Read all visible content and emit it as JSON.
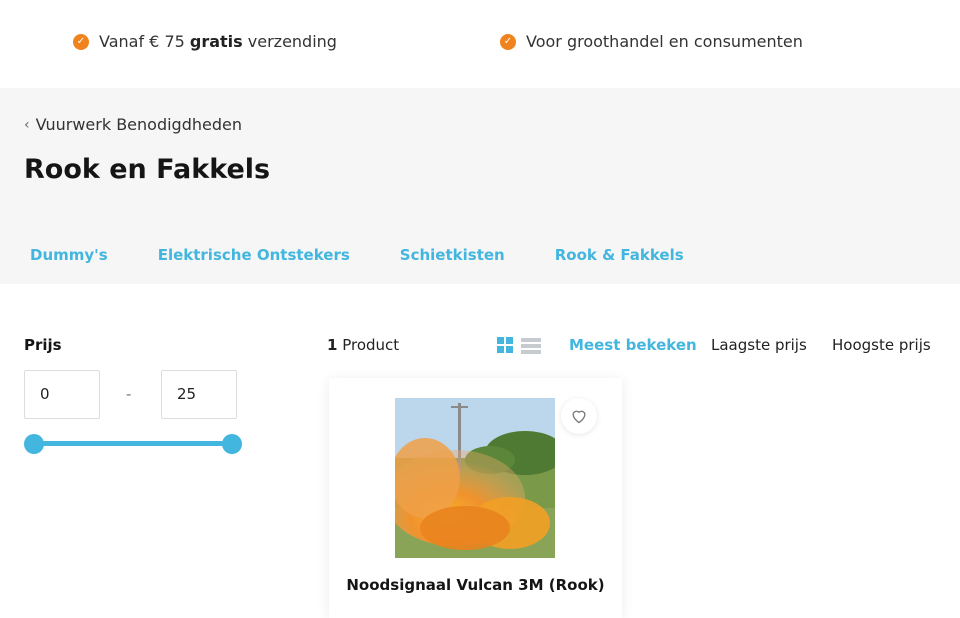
{
  "usps": {
    "item1": {
      "prefix": "Vanaf € 75 ",
      "bold": "gratis",
      "suffix": " verzending"
    },
    "item2": {
      "text": "Voor groothandel en consumenten"
    }
  },
  "category": {
    "breadcrumb": "Vuurwerk Benodigdheden",
    "title": "Rook en Fakkels",
    "subcategories": [
      "Dummy's",
      "Elektrische Ontstekers",
      "Schietkisten",
      "Rook & Fakkels"
    ]
  },
  "filter": {
    "title": "Prijs",
    "min": "0",
    "separator": "-",
    "max": "25"
  },
  "toolbar": {
    "count": "1",
    "count_label": "Product",
    "sort": [
      "Meest bekeken",
      "Laagste prijs",
      "Hoogste prijs"
    ],
    "active_sort": "Meest bekeken"
  },
  "products": [
    {
      "title": "Noodsignaal Vulcan 3M (Rook)",
      "image": "orange-smoke-photo"
    }
  ],
  "colors": {
    "accent": "#43b6df",
    "check": "#f0831e",
    "header_bg": "#f6f6f6"
  }
}
